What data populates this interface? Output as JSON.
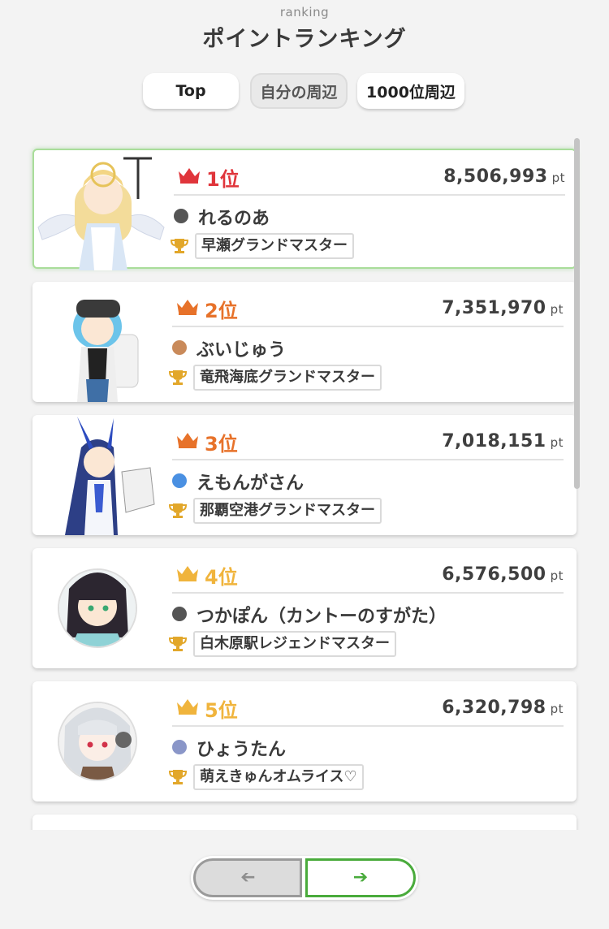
{
  "header": {
    "subtitle": "ranking",
    "title": "ポイントランキング"
  },
  "tabs": [
    {
      "label": "Top",
      "state": "active"
    },
    {
      "label": "自分の周辺",
      "state": "inactive"
    },
    {
      "label": "1000位周辺",
      "state": "normal"
    }
  ],
  "ranking": [
    {
      "rank": "1位",
      "points": "8,506,993",
      "unit": "pt",
      "name": "れるのあ",
      "title": "早瀬グランドマスター",
      "rank_color": "#e0353b",
      "dot_color": "#555555"
    },
    {
      "rank": "2位",
      "points": "7,351,970",
      "unit": "pt",
      "name": "ぶいじゅう",
      "title": "竜飛海底グランドマスター",
      "rank_color": "#e7722a",
      "dot_color": "#c98a5a"
    },
    {
      "rank": "3位",
      "points": "7,018,151",
      "unit": "pt",
      "name": "えもんがさん",
      "title": "那覇空港グランドマスター",
      "rank_color": "#e7722a",
      "dot_color": "#4a90e2"
    },
    {
      "rank": "4位",
      "points": "6,576,500",
      "unit": "pt",
      "name": "つかぽん（カントーのすがた）",
      "title": "白木原駅レジェンドマスター",
      "rank_color": "#f0b43c",
      "dot_color": "#555555"
    },
    {
      "rank": "5位",
      "points": "6,320,798",
      "unit": "pt",
      "name": "ひょうたん",
      "title": "萌えきゅんオムライス♡",
      "rank_color": "#f0b43c",
      "dot_color": "#8a96c8"
    }
  ],
  "pager": {
    "prev_icon": "arrow-left-icon",
    "next_icon": "arrow-right-icon",
    "prev_glyph": "➔",
    "next_glyph": "➔"
  },
  "colors": {
    "accent_green": "#4aab3c",
    "gold": "#e2a72a"
  }
}
